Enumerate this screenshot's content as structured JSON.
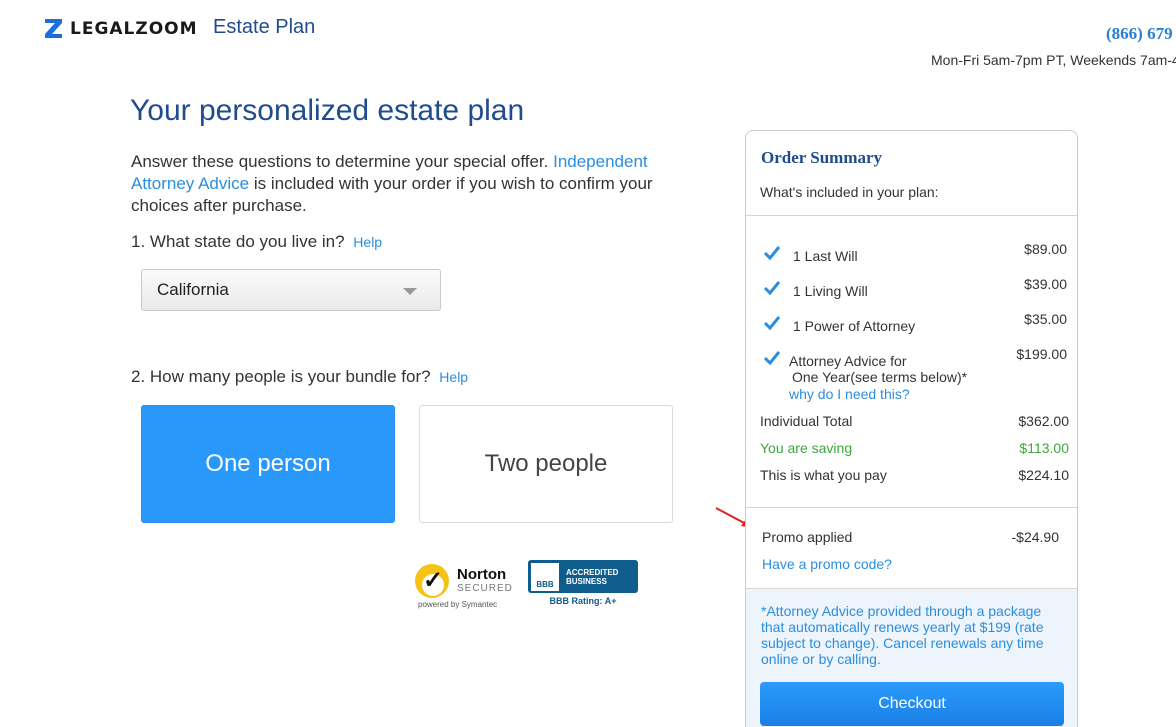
{
  "header": {
    "brand": "LEGALZOOM",
    "product": "Estate Plan",
    "phone": "(866) 679",
    "hours": "Mon-Fri 5am-7pm PT, Weekends 7am-4"
  },
  "main": {
    "title": "Your personalized estate plan",
    "intro_before": "Answer these questions to determine your special offer. ",
    "intro_link": "Independent Attorney Advice",
    "intro_after": " is included with your order if you wish to confirm your choices after purchase.",
    "q1": "1. What state do you live in?",
    "q2": "2. How many people is your bundle for?",
    "help": "Help",
    "state_selected": "California",
    "options": [
      "One person",
      "Two people"
    ],
    "selected_option": "One person"
  },
  "badges": {
    "norton_name": "Norton",
    "norton_secured": "SECURED",
    "norton_powered": "powered by Symantec",
    "bbb_logo": "BBB",
    "bbb_line1": "ACCREDITED",
    "bbb_line2": "BUSINESS",
    "bbb_rating": "BBB Rating: A+"
  },
  "summary": {
    "title": "Order Summary",
    "subtitle": "What's included in your plan:",
    "items": [
      {
        "label": "1 Last Will",
        "price": "$89.00"
      },
      {
        "label": "1 Living Will",
        "price": "$39.00"
      },
      {
        "label": "1 Power of Attorney",
        "price": "$35.00"
      },
      {
        "label_line1": "Attorney Advice for",
        "label_line2": "One Year(see terms below)*",
        "price": "$199.00",
        "link": "why do I need this?"
      }
    ],
    "individual_total_label": "Individual Total",
    "individual_total": "$362.00",
    "saving_label": "You are saving",
    "saving": "$113.00",
    "pay_label": "This is what you pay",
    "pay": "$224.10",
    "promo_label": "Promo applied",
    "promo": "-$24.90",
    "promo_link": "Have a promo code?",
    "note": "*Attorney Advice provided through a package that automatically renews yearly at $199 (rate subject to change). Cancel renewals any time online or by calling.",
    "checkout": "Checkout",
    "colors": {
      "accent": "#2998fb",
      "title": "#1f4c8f",
      "link": "#2a8ee0",
      "saving": "#3aa83a",
      "annotation": "#e02020"
    }
  }
}
